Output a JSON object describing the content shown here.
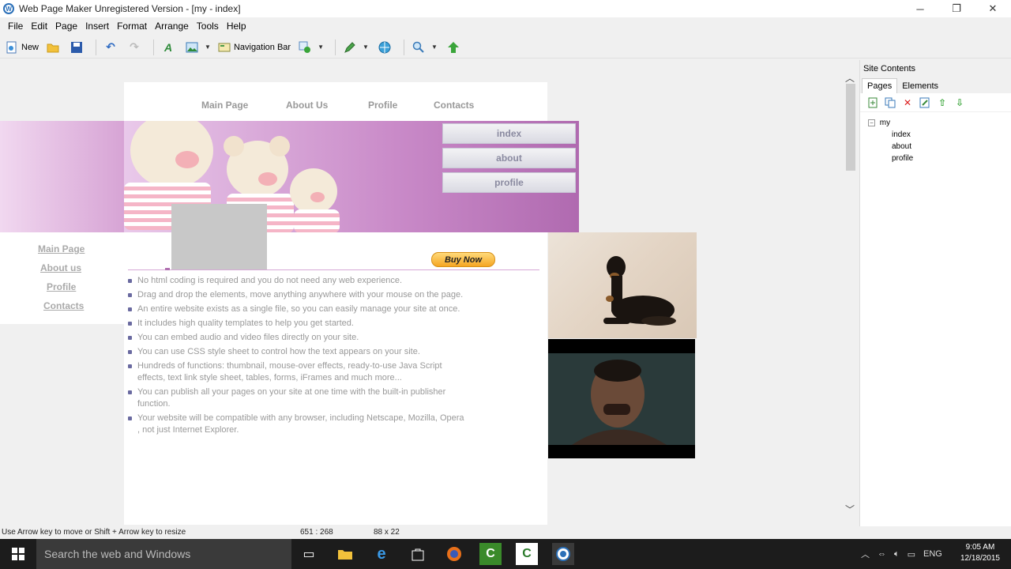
{
  "window": {
    "title": "Web Page Maker Unregistered Version - [my - index]",
    "minimize": "─",
    "restore": "❐",
    "close": "✕"
  },
  "menu": [
    "File",
    "Edit",
    "Page",
    "Insert",
    "Format",
    "Arrange",
    "Tools",
    "Help"
  ],
  "toolbar": {
    "new_label": "New",
    "navbar_label": "Navigation Bar"
  },
  "page": {
    "topnav": [
      "Main Page",
      "About Us",
      "Profile",
      "Contacts"
    ],
    "sidenav": [
      "index",
      "about",
      "profile"
    ],
    "leftmenu": [
      "Main Page",
      "About us",
      "Profile",
      "Contacts"
    ],
    "buy_now": "Buy Now",
    "bullets": [
      "No html coding is required and you do not need any web experience.",
      "Drag and drop the elements, move anything anywhere with your mouse on the page.",
      "An entire website exists as a single file, so you can easily manage your site at once.",
      "It includes high quality templates to help you get started.",
      "You can embed audio and video files directly on your site.",
      "You can use CSS style sheet to control how the text appears on your site.",
      "Hundreds of functions: thumbnail, mouse-over effects, ready-to-use Java Script effects, text link style sheet, tables, forms, iFrames and much more...",
      "You can publish all your pages on your site at one time with the built-in publisher function.",
      "Your website will be compatible with any browser, including Netscape, Mozilla, Opera , not just Internet Explorer."
    ]
  },
  "panel": {
    "title": "Site Contents",
    "tabs": [
      "Pages",
      "Elements"
    ],
    "tree_root": "my",
    "tree_pages": [
      "index",
      "about",
      "profile"
    ]
  },
  "status": {
    "hint": "Use Arrow key to move or Shift + Arrow key to resize",
    "position": "651 : 268",
    "size": "88 x 22"
  },
  "taskbar": {
    "search_placeholder": "Search the web and Windows",
    "lang": "ENG",
    "time": "9:05 AM",
    "date": "12/18/2015"
  },
  "colors": {
    "accent": "#c98ac8",
    "taskbar": "#1c1c1c"
  }
}
